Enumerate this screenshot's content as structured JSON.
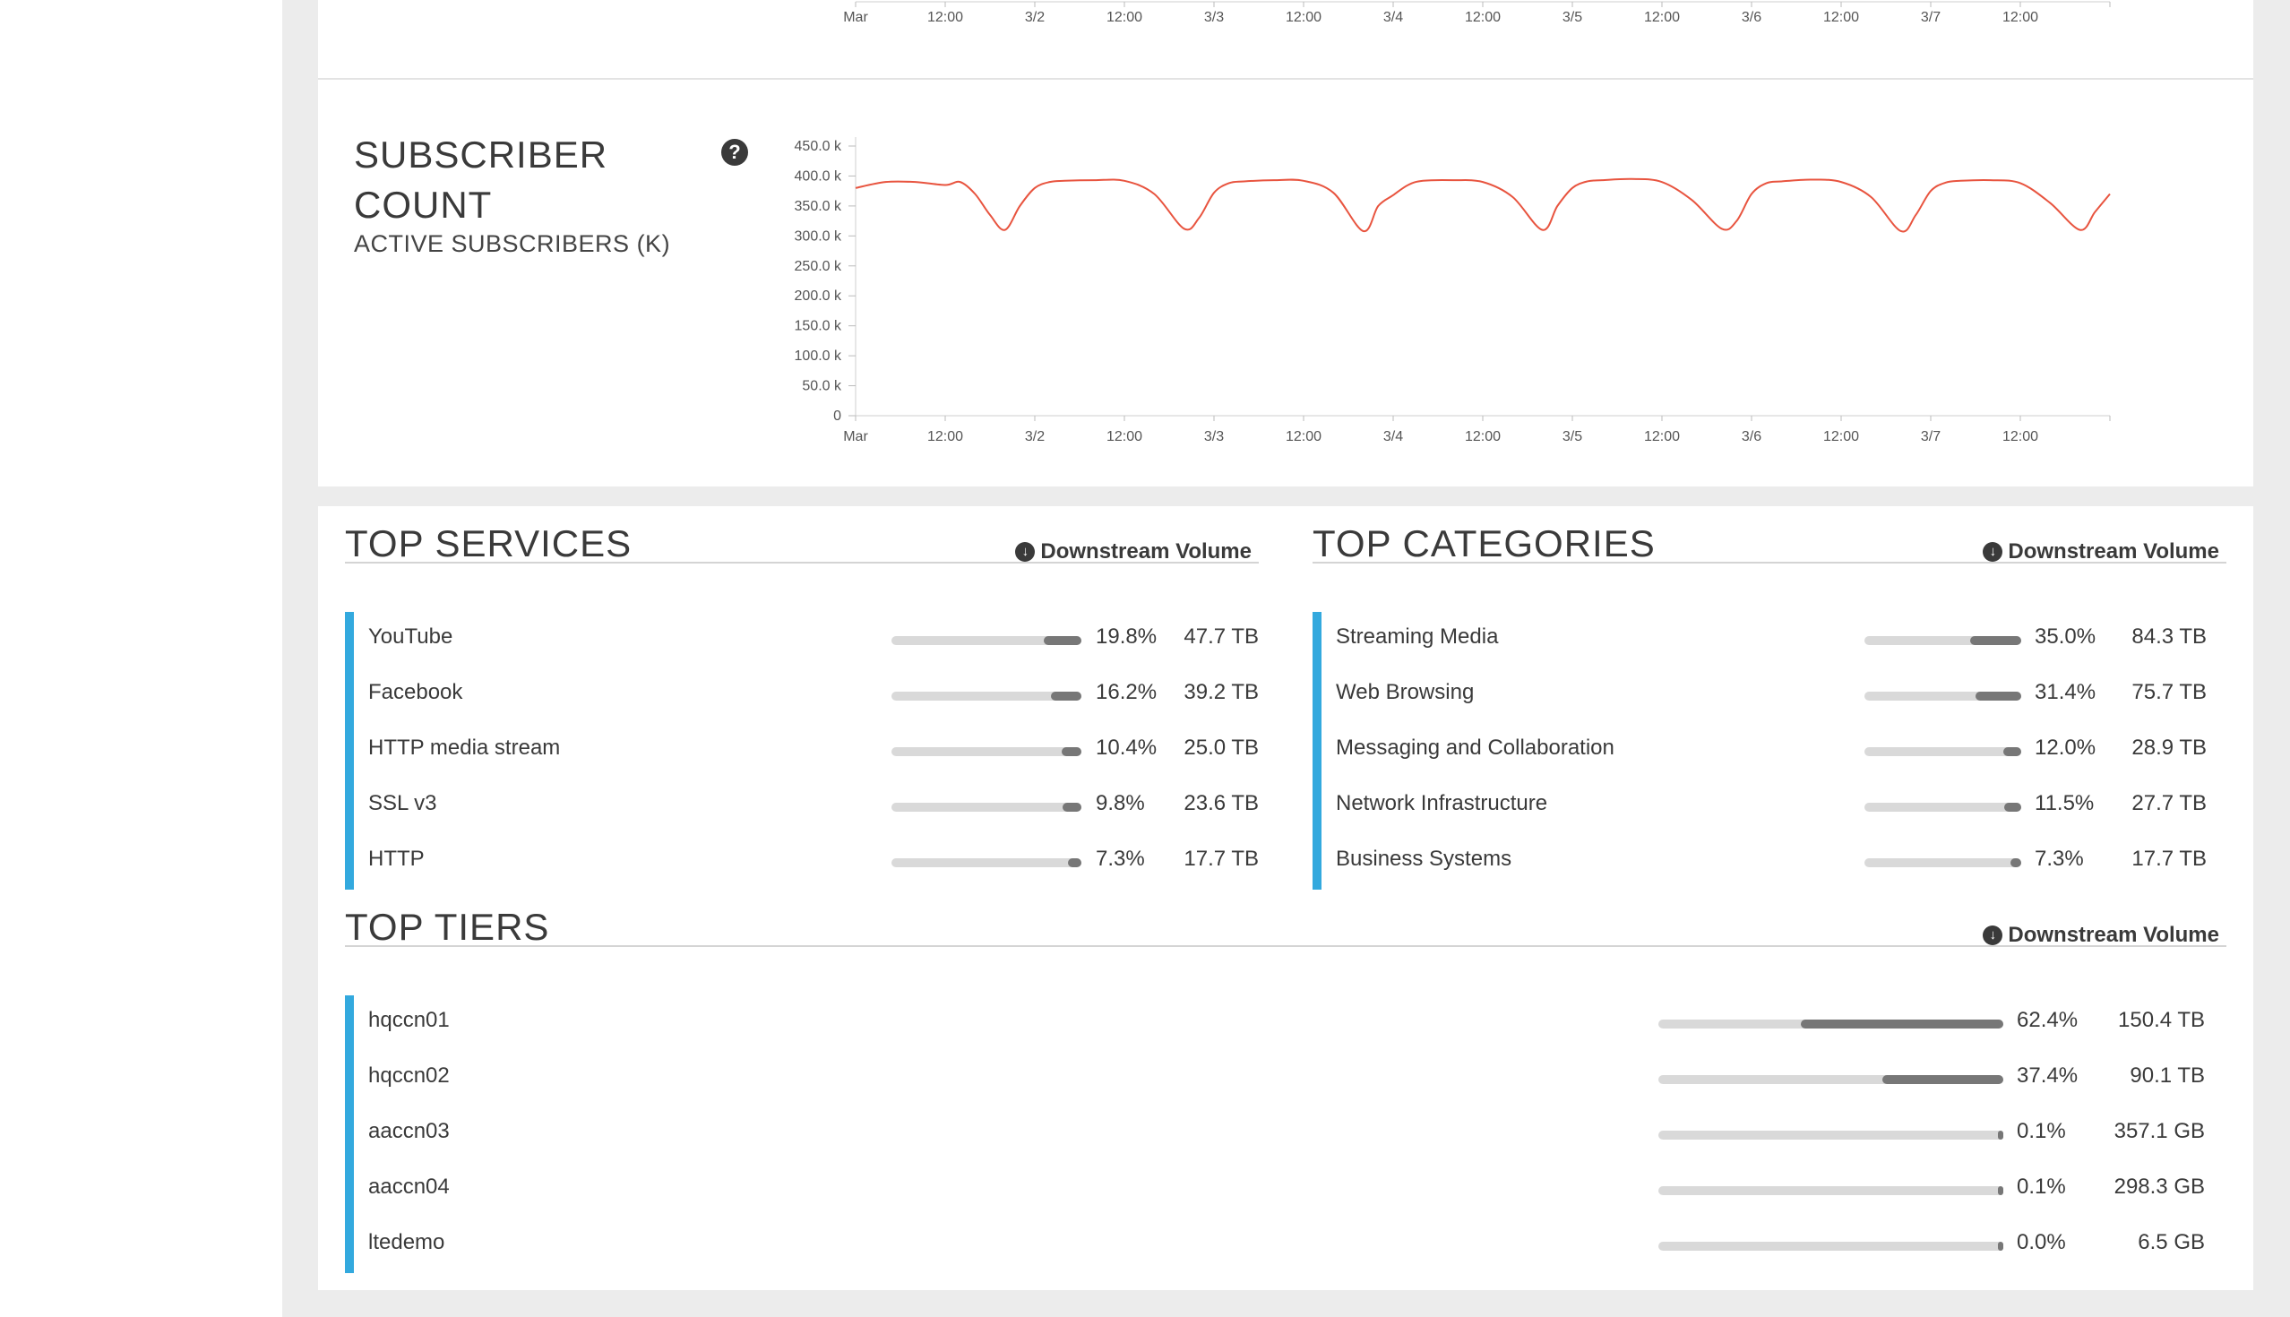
{
  "top_chart": {
    "x_ticks": [
      "Mar",
      "12:00",
      "3/2",
      "12:00",
      "3/3",
      "12:00",
      "3/4",
      "12:00",
      "3/5",
      "12:00",
      "3/6",
      "12:00",
      "3/7",
      "12:00"
    ]
  },
  "subscriber_panel": {
    "title": "SUBSCRIBER COUNT",
    "subtitle": "ACTIVE SUBSCRIBERS (K)",
    "help_icon": "question-circle-icon"
  },
  "chart_data": {
    "type": "line",
    "title": "",
    "xlabel": "",
    "ylabel": "",
    "x_ticks": [
      "Mar",
      "12:00",
      "3/2",
      "12:00",
      "3/3",
      "12:00",
      "3/4",
      "12:00",
      "3/5",
      "12:00",
      "3/6",
      "12:00",
      "3/7",
      "12:00"
    ],
    "y_ticks": [
      "0",
      "50.0 k",
      "100.0 k",
      "150.0 k",
      "200.0 k",
      "250.0 k",
      "300.0 k",
      "350.0 k",
      "400.0 k",
      "450.0 k"
    ],
    "ylim": [
      0,
      450000
    ],
    "xlim_hours": [
      0,
      168
    ],
    "line_color": "#e8543f",
    "grid": false,
    "series": [
      {
        "x_hours": [
          0,
          4,
          8,
          12,
          14,
          16,
          18,
          20,
          22,
          24,
          26,
          28,
          32,
          36,
          40,
          44,
          46,
          48,
          50,
          52,
          56,
          60,
          64,
          68,
          70,
          72,
          74,
          76,
          80,
          84,
          88,
          92,
          94,
          96,
          98,
          100,
          104,
          108,
          112,
          116,
          118,
          120,
          122,
          124,
          128,
          132,
          136,
          140,
          142,
          144,
          146,
          148,
          152,
          156,
          160,
          164,
          166,
          168
        ],
        "values": [
          380000,
          390000,
          390000,
          385000,
          390000,
          370000,
          335000,
          310000,
          350000,
          380000,
          390000,
          392000,
          393000,
          392000,
          370000,
          312000,
          330000,
          372000,
          388000,
          391000,
          393000,
          392000,
          372000,
          308000,
          350000,
          368000,
          385000,
          392000,
          393000,
          390000,
          365000,
          310000,
          350000,
          380000,
          391000,
          393000,
          395000,
          390000,
          360000,
          312000,
          325000,
          370000,
          388000,
          391000,
          394000,
          390000,
          365000,
          308000,
          335000,
          375000,
          389000,
          392000,
          393000,
          388000,
          355000,
          310000,
          340000,
          370000
        ]
      }
    ]
  },
  "top_services": {
    "title": "TOP SERVICES",
    "sort_label": "Downstream Volume",
    "sort_icon": "arrow-down-circle-icon",
    "items": [
      {
        "name": "YouTube",
        "pct": "19.8%",
        "vol": "47.7 TB",
        "share": 0.198
      },
      {
        "name": "Facebook",
        "pct": "16.2%",
        "vol": "39.2 TB",
        "share": 0.162
      },
      {
        "name": "HTTP media stream",
        "pct": "10.4%",
        "vol": "25.0 TB",
        "share": 0.104
      },
      {
        "name": "SSL v3",
        "pct": "9.8%",
        "vol": "23.6 TB",
        "share": 0.098
      },
      {
        "name": "HTTP",
        "pct": "7.3%",
        "vol": "17.7 TB",
        "share": 0.073
      }
    ]
  },
  "top_categories": {
    "title": "TOP CATEGORIES",
    "sort_label": "Downstream Volume",
    "sort_icon": "arrow-down-circle-icon",
    "items": [
      {
        "name": "Streaming Media",
        "pct": "35.0%",
        "vol": "84.3 TB",
        "share": 0.35
      },
      {
        "name": "Web Browsing",
        "pct": "31.4%",
        "vol": "75.7 TB",
        "share": 0.314
      },
      {
        "name": "Messaging and Collaboration",
        "pct": "12.0%",
        "vol": "28.9 TB",
        "share": 0.12
      },
      {
        "name": "Network Infrastructure",
        "pct": "11.5%",
        "vol": "27.7 TB",
        "share": 0.115
      },
      {
        "name": "Business Systems",
        "pct": "7.3%",
        "vol": "17.7 TB",
        "share": 0.073
      }
    ]
  },
  "top_tiers": {
    "title": "TOP TIERS",
    "sort_label": "Downstream Volume",
    "sort_icon": "arrow-down-circle-icon",
    "items": [
      {
        "name": "hqccn01",
        "pct": "62.4%",
        "vol": "150.4 TB",
        "share": 0.624
      },
      {
        "name": "hqccn02",
        "pct": "37.4%",
        "vol": "90.1 TB",
        "share": 0.374
      },
      {
        "name": "aaccn03",
        "pct": "0.1%",
        "vol": "357.1 GB",
        "share": 0.001
      },
      {
        "name": "aaccn04",
        "pct": "0.1%",
        "vol": "298.3 GB",
        "share": 0.001
      },
      {
        "name": "ltedemo",
        "pct": "0.0%",
        "vol": "6.5 GB",
        "share": 0.0
      }
    ]
  }
}
